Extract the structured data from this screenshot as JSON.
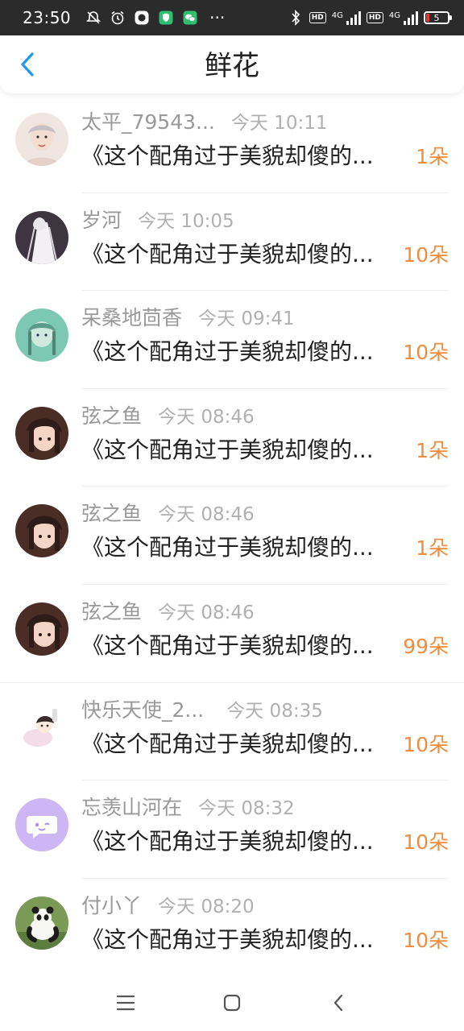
{
  "status_bar": {
    "time": "23:50",
    "dots": "···",
    "network_1": "4G",
    "network_2": "4G",
    "battery": "5",
    "hd": "HD"
  },
  "header": {
    "title": "鲜花"
  },
  "gifts": [
    {
      "user": "太平_79543...",
      "time": "今天 10:11",
      "book": "《这个配角过于美貌却傻的...",
      "count": "1朵",
      "avatar_color": "#e8d8d0"
    },
    {
      "user": "岁河",
      "time": "今天 10:05",
      "book": "《这个配角过于美貌却傻的...",
      "count": "10朵",
      "avatar_color": "#3d3540"
    },
    {
      "user": "呆桑地茴香",
      "time": "今天 09:41",
      "book": "《这个配角过于美貌却傻的...",
      "count": "10朵",
      "avatar_color": "#6ec0a8"
    },
    {
      "user": "弦之鱼",
      "time": "今天 08:46",
      "book": "《这个配角过于美貌却傻的...",
      "count": "1朵",
      "avatar_color": "#5a3a30"
    },
    {
      "user": "弦之鱼",
      "time": "今天 08:46",
      "book": "《这个配角过于美貌却傻的...",
      "count": "1朵",
      "avatar_color": "#5a3a30"
    },
    {
      "user": "弦之鱼",
      "time": "今天 08:46",
      "book": "《这个配角过于美貌却傻的...",
      "count": "99朵",
      "avatar_color": "#5a3a30"
    },
    {
      "user": "快乐天使_2...",
      "time": "今天 08:35",
      "book": "《这个配角过于美貌却傻的...",
      "count": "10朵",
      "avatar_color": "#f4eef0"
    },
    {
      "user": "忘羡山河在",
      "time": "今天 08:32",
      "book": "《这个配角过于美貌却傻的...",
      "count": "10朵",
      "avatar_color": "#c9b3f2"
    },
    {
      "user": "付小丫",
      "time": "今天 08:20",
      "book": "《这个配角过于美貌却傻的...",
      "count": "10朵",
      "avatar_color": "#6b8a4a"
    }
  ],
  "colors": {
    "accent_blue": "#2196f3",
    "flower_count": "#f28c3c",
    "username": "#999999"
  }
}
